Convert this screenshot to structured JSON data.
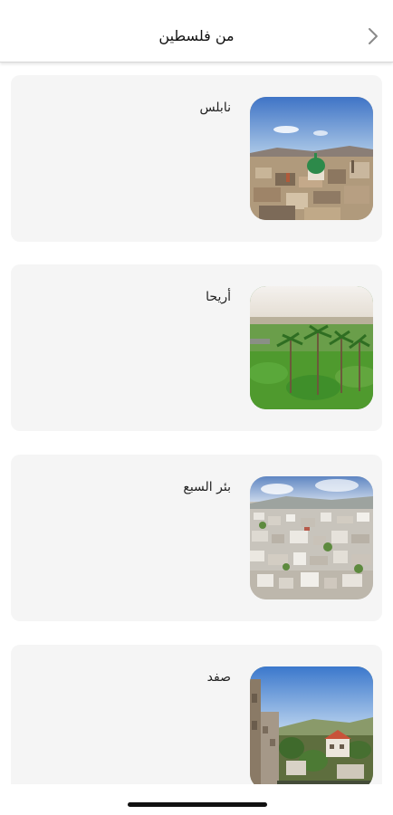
{
  "header": {
    "title": "من فلسطين"
  },
  "items": [
    {
      "name": "نابلس"
    },
    {
      "name": "أريحا"
    },
    {
      "name": "بئر السبع"
    },
    {
      "name": "صفد"
    }
  ]
}
